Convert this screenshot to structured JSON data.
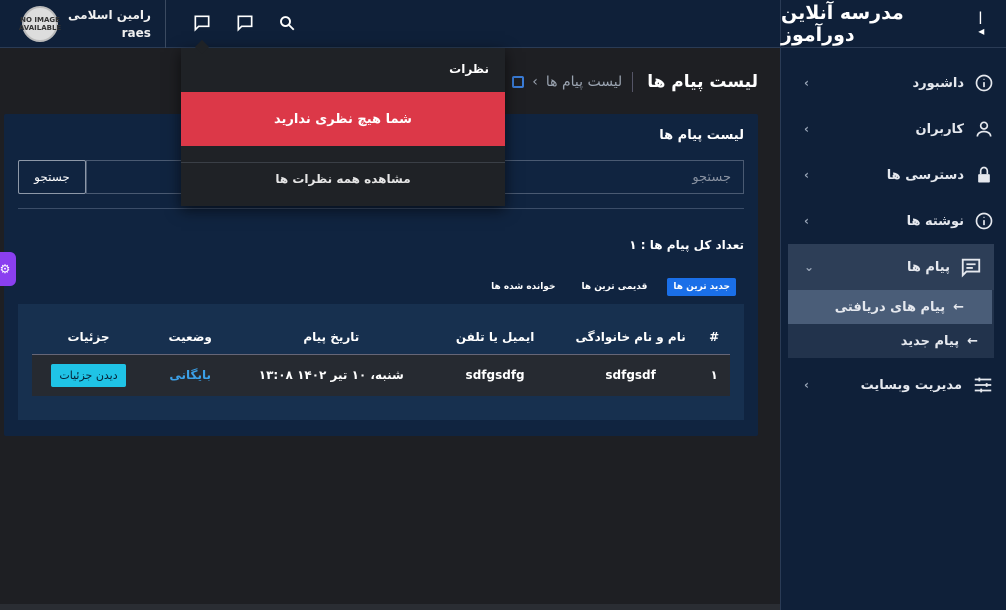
{
  "brand": {
    "title": "مدرسه آنلاین دورآموز",
    "collapse": "|◂"
  },
  "user": {
    "name": "رامین اسلامی",
    "username": "raes",
    "avatar_text": "NO IMAGE AVAILABLE"
  },
  "sidebar": {
    "items": [
      {
        "label": "داشبورد",
        "icon": "info-icon"
      },
      {
        "label": "کاربران",
        "icon": "user-icon"
      },
      {
        "label": "دسترسی ها",
        "icon": "lock-icon"
      },
      {
        "label": "نوشته ها",
        "icon": "info-icon"
      },
      {
        "label": "پیام ها",
        "icon": "message-icon"
      },
      {
        "label": "مدیریت وبسایت",
        "icon": "sliders-icon"
      }
    ],
    "sub_items": [
      {
        "label": "پیام های دریافتی"
      },
      {
        "label": "پیام جدید"
      }
    ]
  },
  "page": {
    "title": "لیست پیام ها",
    "breadcrumb": "لیست پیام ها"
  },
  "card": {
    "title": "لیست پیام ها",
    "search_placeholder": "جستجو",
    "search_button": "جستجو",
    "count_label": "تعداد کل پیام ها : ۱",
    "filters": [
      "جدید ترین ها",
      "قدیمی ترین ها",
      "خوانده شده ها"
    ]
  },
  "table": {
    "headers": [
      "#",
      "نام و نام خانوادگی",
      "ایمیل یا تلفن",
      "تاریخ پیام",
      "وضعیت",
      "جزئیات"
    ],
    "rows": [
      {
        "index": "۱",
        "name": "sdfgsdf",
        "contact": "sdfgsdfg",
        "date": "شنبه، ۱۰ تیر ۱۴۰۲ ۱۳:۰۸",
        "status": "بایگانی",
        "action": "دیدن جزئیات"
      }
    ]
  },
  "notifications": {
    "title": "نظرات",
    "empty_message": "شما هیچ نظری ندارید",
    "view_all": "مشاهده همه نظرات ها"
  },
  "colors": {
    "accent": "#1a6fe8",
    "alert": "#dc3848",
    "details_button": "#1fc3e6",
    "sidebar": "#0f2039"
  }
}
